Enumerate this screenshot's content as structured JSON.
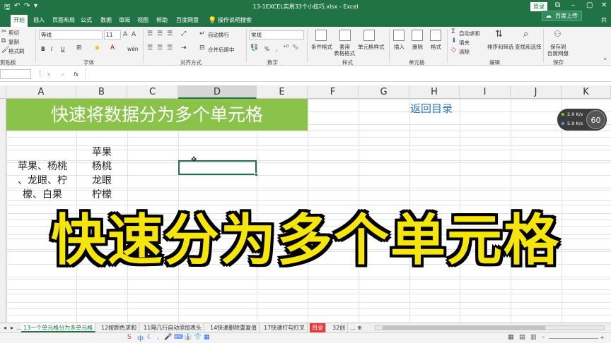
{
  "window": {
    "title": "13-1EXCEL实用33个小技巧.xlsx - Excel",
    "login_label": "登录",
    "share_label": "共",
    "upload_label": "百度上传"
  },
  "tabs": [
    "开始",
    "插入",
    "页面布局",
    "公式",
    "数据",
    "审阅",
    "视图",
    "帮助",
    "百度网盘",
    "操作说明搜索"
  ],
  "ribbon": {
    "clipboard": {
      "cut": "剪切",
      "copy": "复制",
      "format_painter": "格式刷",
      "label": "剪贴板"
    },
    "font": {
      "name": "等线",
      "size": "11",
      "bold": "B",
      "italic": "I",
      "underline": "U",
      "wen": "wén",
      "label": "字体"
    },
    "alignment": {
      "wrap": "自动换行",
      "merge": "合并后居中",
      "label": "对齐方式"
    },
    "number": {
      "format": "常规",
      "percent": "%",
      "comma": ",",
      "label": "数字"
    },
    "styles": {
      "conditional": "条件格式",
      "table_format_1": "套用",
      "table_format_2": "表格格式",
      "cell_styles": "单元格样式",
      "label": "样式"
    },
    "cells": {
      "insert": "插入",
      "delete": "删除",
      "format": "格式",
      "label": "单元格"
    },
    "editing": {
      "autosum": "自动求和",
      "fill": "填充",
      "clear": "清除",
      "sort": "排序和筛选",
      "find": "查找和选择",
      "label": "编辑"
    },
    "save": {
      "save_1": "保存到",
      "save_2": "百度网盘",
      "label": "保存"
    }
  },
  "formula_bar": {
    "cancel": "×",
    "enter": "✓",
    "fx": "fx",
    "content": ""
  },
  "columns": [
    "A",
    "B",
    "C",
    "D",
    "E",
    "F",
    "G",
    "H",
    "I",
    "J",
    "K"
  ],
  "selected_column": "D",
  "sheet": {
    "banner": "快速将数据分为多个单元格",
    "return_link": "返回目录",
    "cell_a_lines": [
      "苹果、杨桃",
      "、龙眼、柠",
      "檬、白果"
    ],
    "cell_b_lines": [
      "苹果",
      "杨桃",
      "龙眼",
      "柠檬"
    ]
  },
  "overlay_caption": "快速分为多个单元格",
  "speed_widget": {
    "up": "2.9",
    "up_unit": "K/s",
    "down": "5.9",
    "down_unit": "K/s",
    "value": "60"
  },
  "sheet_tabs": {
    "tabs": [
      "13一个单元格分为多单元格",
      "12按颜色求和",
      "11隔几行自动添加表头",
      "14快速删除重复值",
      "17快速打勾打叉",
      "目录",
      "32创"
    ],
    "active": 0
  },
  "status": {
    "zoom": "+"
  }
}
